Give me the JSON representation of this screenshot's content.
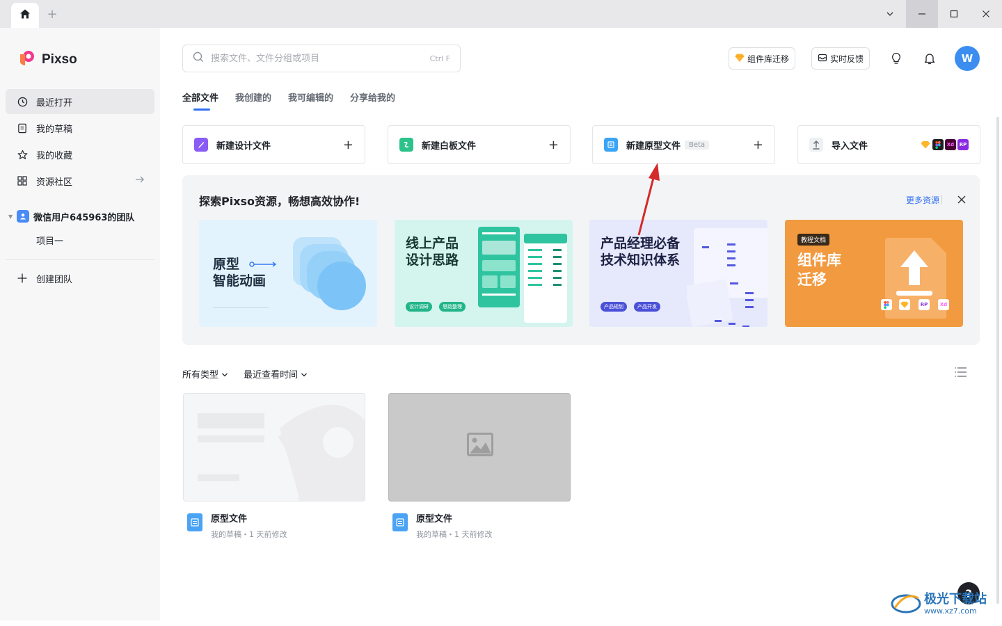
{
  "titlebar": {
    "new_tab": "+"
  },
  "sidebar": {
    "app_name": "Pixso",
    "items": [
      {
        "label": "最近打开",
        "icon": "clock-icon"
      },
      {
        "label": "我的草稿",
        "icon": "draft-icon"
      },
      {
        "label": "我的收藏",
        "icon": "star-icon"
      },
      {
        "label": "资源社区",
        "icon": "grid-icon"
      }
    ],
    "team_name": "微信用户645963的团队",
    "project": "项目一",
    "create_team": "创建团队"
  },
  "header": {
    "search_placeholder": "搜索文件、文件分组或项目",
    "search_shortcut": "Ctrl F",
    "migrate_button": "组件库迁移",
    "feedback_button": "实时反馈",
    "avatar_letter": "W"
  },
  "tabs": [
    "全部文件",
    "我创建的",
    "我可编辑的",
    "分享给我的"
  ],
  "create_cards": [
    {
      "label": "新建设计文件"
    },
    {
      "label": "新建白板文件"
    },
    {
      "label": "新建原型文件",
      "badge": "Beta"
    },
    {
      "label": "导入文件"
    }
  ],
  "import_formats": [
    "Xd",
    "RP"
  ],
  "resources": {
    "title": "探索Pixso资源，畅想高效协作!",
    "more_link": "更多资源",
    "banners": [
      {
        "title_line1": "原型",
        "title_line2": "智能动画"
      },
      {
        "title_line1": "线上产品",
        "title_line2": "设计思路",
        "chips": [
          "设计调研",
          "思路整理"
        ]
      },
      {
        "title_line1": "产品经理必备",
        "title_line2": "技术知识体系",
        "chips": [
          "产品规划",
          "产品开发"
        ]
      },
      {
        "tag": "教程文档",
        "title_line1": "组件库",
        "title_line2": "迁移",
        "formats": [
          "RP",
          "Xd"
        ]
      }
    ]
  },
  "filters": {
    "type": "所有类型",
    "sort": "最近查看时间"
  },
  "files": [
    {
      "name": "原型文件",
      "meta": "我的草稿・1 天前修改"
    },
    {
      "name": "原型文件",
      "meta": "我的草稿・1 天前修改"
    }
  ],
  "help": "?",
  "watermark": {
    "text": "极光下载站",
    "url": "www.xz7.com"
  },
  "colors": {
    "accent": "#2f6ff3",
    "avatar": "#3b8ef0",
    "annotation_arrow": "#d42a2a"
  }
}
